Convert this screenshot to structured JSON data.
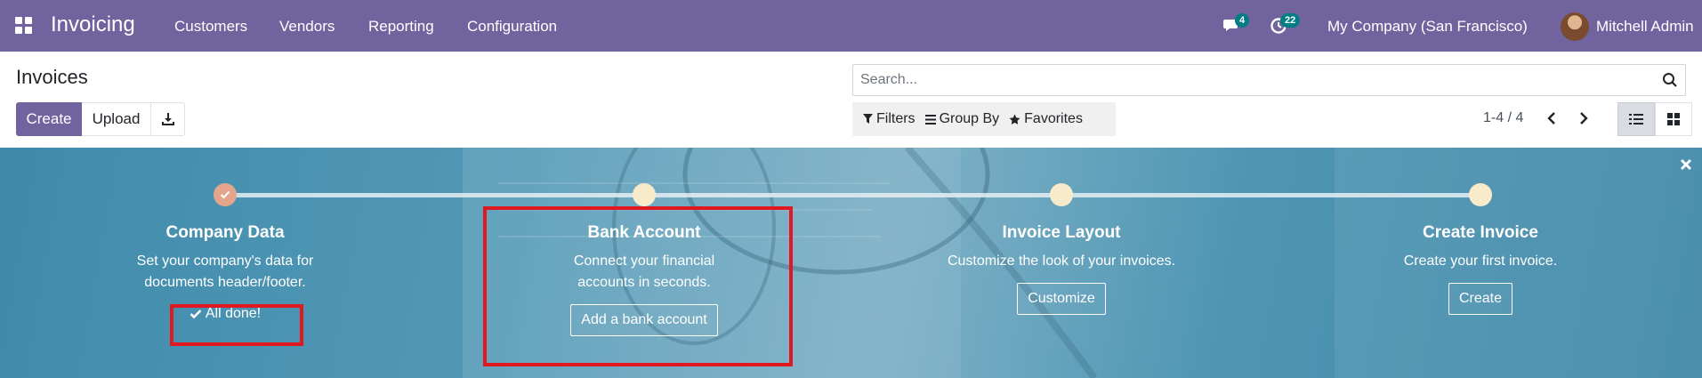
{
  "navbar": {
    "app_title": "Invoicing",
    "menu": [
      "Customers",
      "Vendors",
      "Reporting",
      "Configuration"
    ],
    "messages_count": "4",
    "activities_count": "22",
    "company": "My Company (San Francisco)",
    "user": "Mitchell Admin",
    "bg_color": "#71639e"
  },
  "control_panel": {
    "title": "Invoices",
    "create_label": "Create",
    "upload_label": "Upload",
    "search_placeholder": "Search...",
    "filters_label": "Filters",
    "groupby_label": "Group By",
    "favorites_label": "Favorites",
    "pager": "1-4 / 4"
  },
  "onboarding": {
    "steps": [
      {
        "title": "Company Data",
        "description": "Set your company's data for documents header/footer.",
        "status": "All done!"
      },
      {
        "title": "Bank Account",
        "description": "Connect your financial accounts in seconds.",
        "button": "Add a bank account"
      },
      {
        "title": "Invoice Layout",
        "description": "Customize the look of your invoices.",
        "button": "Customize"
      },
      {
        "title": "Create Invoice",
        "description": "Create your first invoice.",
        "button": "Create"
      }
    ],
    "highlight_color": "#e1181f"
  }
}
